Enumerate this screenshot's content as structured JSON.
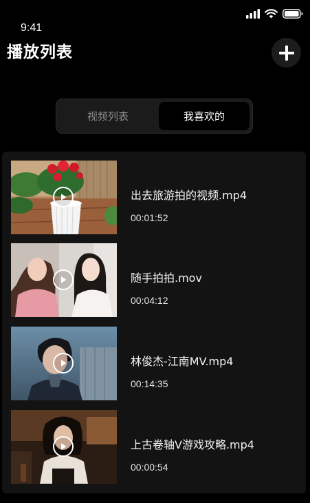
{
  "status_bar": {
    "time": "9:41",
    "icons": [
      "signal-icon",
      "wifi-icon",
      "battery-icon"
    ]
  },
  "header": {
    "title": "播放列表",
    "add_icon": "plus-icon"
  },
  "tabs": [
    {
      "label": "视频列表",
      "selected": false
    },
    {
      "label": "我喜欢的",
      "selected": true
    }
  ],
  "videos": [
    {
      "name": "出去旅游拍的视频.mp4",
      "duration": "00:01:52",
      "thumbnail": "potted-rose"
    },
    {
      "name": "随手拍拍.mov",
      "duration": "00:04:12",
      "thumbnail": "two-women"
    },
    {
      "name": "林俊杰-江南MV.mp4",
      "duration": "00:14:35",
      "thumbnail": "man-portrait"
    },
    {
      "name": "上古卷轴V游戏攻略.mp4",
      "duration": "00:00:54",
      "thumbnail": "game-character"
    }
  ],
  "colors": {
    "background": "#000000",
    "panel": "#131313",
    "segmented": "#1b1b1b",
    "inactive_tab_text": "#8d8d8d",
    "text": "#ffffff"
  }
}
